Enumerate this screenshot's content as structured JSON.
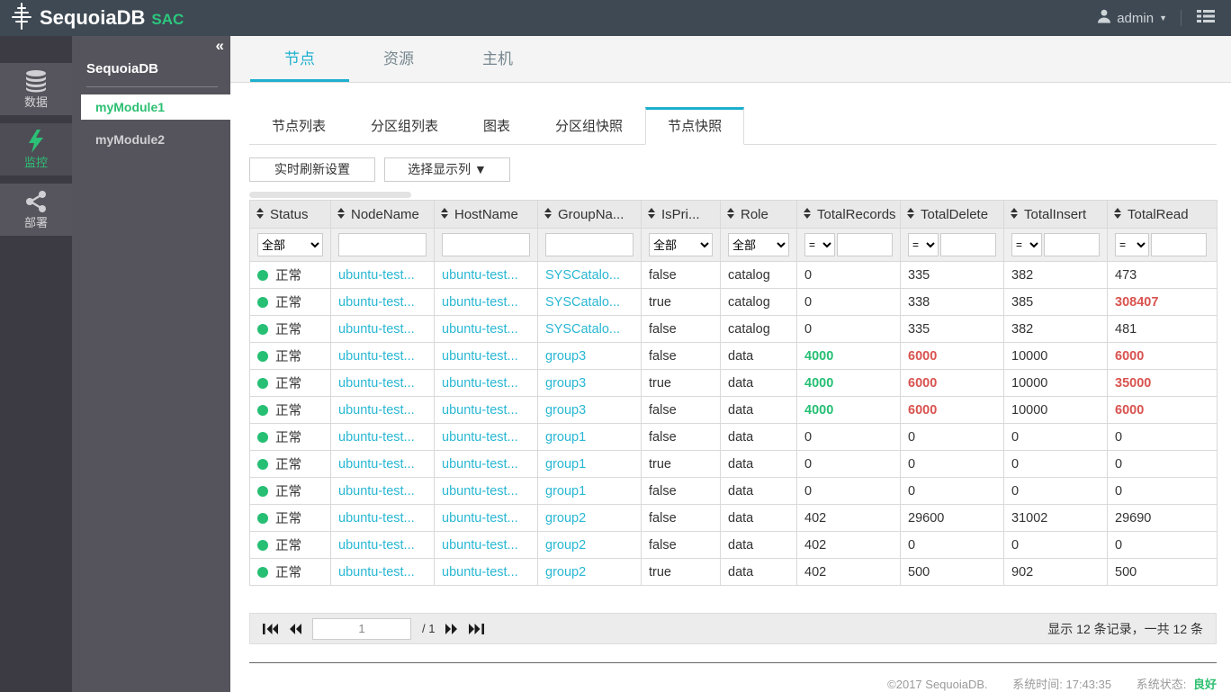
{
  "colors": {
    "accent": "#1db0cf",
    "green": "#26bf74",
    "red": "#d9534f",
    "link": "#29b7d3",
    "brand_green": "#2cc77d",
    "header_bg": "#3e4953"
  },
  "topbar": {
    "brand": "SequoiaDB",
    "brand_suffix": "SAC",
    "user": "admin"
  },
  "rail": {
    "items": [
      {
        "label": "数据",
        "icon": "database-icon",
        "active": false
      },
      {
        "label": "监控",
        "icon": "lightning-icon",
        "active": true
      },
      {
        "label": "部署",
        "icon": "share-icon",
        "active": false
      }
    ]
  },
  "modules": {
    "title": "SequoiaDB",
    "collapse_icon": "«",
    "items": [
      {
        "label": "myModule1",
        "active": true
      },
      {
        "label": "myModule2",
        "active": false
      }
    ]
  },
  "tabs": [
    {
      "label": "节点",
      "active": true
    },
    {
      "label": "资源",
      "active": false
    },
    {
      "label": "主机",
      "active": false
    }
  ],
  "subtabs": [
    {
      "label": "节点列表",
      "active": false
    },
    {
      "label": "分区组列表",
      "active": false
    },
    {
      "label": "图表",
      "active": false
    },
    {
      "label": "分区组快照",
      "active": false
    },
    {
      "label": "节点快照",
      "active": true
    }
  ],
  "toolbar": {
    "refresh_button": "实时刷新设置",
    "columns_button": "选择显示列 ▼"
  },
  "table": {
    "columns": [
      {
        "label": "Status",
        "filter": "select"
      },
      {
        "label": "NodeName",
        "filter": "text"
      },
      {
        "label": "HostName",
        "filter": "text"
      },
      {
        "label": "GroupNa...",
        "filter": "text"
      },
      {
        "label": "IsPri...",
        "filter": "select"
      },
      {
        "label": "Role",
        "filter": "select"
      },
      {
        "label": "TotalRecords",
        "filter": "numeric"
      },
      {
        "label": "TotalDelete",
        "filter": "numeric"
      },
      {
        "label": "TotalInsert",
        "filter": "numeric"
      },
      {
        "label": "TotalRead",
        "filter": "numeric"
      }
    ],
    "filters": {
      "all_label": "全部",
      "eq_label": "="
    },
    "rows": [
      {
        "status": "正常",
        "node": "ubuntu-test...",
        "host": "ubuntu-test...",
        "group": "SYSCatalo...",
        "is_primary": "false",
        "role": "catalog",
        "total_records": {
          "v": "0"
        },
        "total_delete": {
          "v": "335"
        },
        "total_insert": {
          "v": "382"
        },
        "total_read": {
          "v": "473"
        }
      },
      {
        "status": "正常",
        "node": "ubuntu-test...",
        "host": "ubuntu-test...",
        "group": "SYSCatalo...",
        "is_primary": "true",
        "role": "catalog",
        "total_records": {
          "v": "0"
        },
        "total_delete": {
          "v": "338"
        },
        "total_insert": {
          "v": "385"
        },
        "total_read": {
          "v": "308407",
          "c": "red"
        }
      },
      {
        "status": "正常",
        "node": "ubuntu-test...",
        "host": "ubuntu-test...",
        "group": "SYSCatalo...",
        "is_primary": "false",
        "role": "catalog",
        "total_records": {
          "v": "0"
        },
        "total_delete": {
          "v": "335"
        },
        "total_insert": {
          "v": "382"
        },
        "total_read": {
          "v": "481"
        }
      },
      {
        "status": "正常",
        "node": "ubuntu-test...",
        "host": "ubuntu-test...",
        "group": "group3",
        "is_primary": "false",
        "role": "data",
        "total_records": {
          "v": "4000",
          "c": "green"
        },
        "total_delete": {
          "v": "6000",
          "c": "red"
        },
        "total_insert": {
          "v": "10000"
        },
        "total_read": {
          "v": "6000",
          "c": "red"
        }
      },
      {
        "status": "正常",
        "node": "ubuntu-test...",
        "host": "ubuntu-test...",
        "group": "group3",
        "is_primary": "true",
        "role": "data",
        "total_records": {
          "v": "4000",
          "c": "green"
        },
        "total_delete": {
          "v": "6000",
          "c": "red"
        },
        "total_insert": {
          "v": "10000"
        },
        "total_read": {
          "v": "35000",
          "c": "red"
        }
      },
      {
        "status": "正常",
        "node": "ubuntu-test...",
        "host": "ubuntu-test...",
        "group": "group3",
        "is_primary": "false",
        "role": "data",
        "total_records": {
          "v": "4000",
          "c": "green"
        },
        "total_delete": {
          "v": "6000",
          "c": "red"
        },
        "total_insert": {
          "v": "10000"
        },
        "total_read": {
          "v": "6000",
          "c": "red"
        }
      },
      {
        "status": "正常",
        "node": "ubuntu-test...",
        "host": "ubuntu-test...",
        "group": "group1",
        "is_primary": "false",
        "role": "data",
        "total_records": {
          "v": "0"
        },
        "total_delete": {
          "v": "0"
        },
        "total_insert": {
          "v": "0"
        },
        "total_read": {
          "v": "0"
        }
      },
      {
        "status": "正常",
        "node": "ubuntu-test...",
        "host": "ubuntu-test...",
        "group": "group1",
        "is_primary": "true",
        "role": "data",
        "total_records": {
          "v": "0"
        },
        "total_delete": {
          "v": "0"
        },
        "total_insert": {
          "v": "0"
        },
        "total_read": {
          "v": "0"
        }
      },
      {
        "status": "正常",
        "node": "ubuntu-test...",
        "host": "ubuntu-test...",
        "group": "group1",
        "is_primary": "false",
        "role": "data",
        "total_records": {
          "v": "0"
        },
        "total_delete": {
          "v": "0"
        },
        "total_insert": {
          "v": "0"
        },
        "total_read": {
          "v": "0"
        }
      },
      {
        "status": "正常",
        "node": "ubuntu-test...",
        "host": "ubuntu-test...",
        "group": "group2",
        "is_primary": "false",
        "role": "data",
        "total_records": {
          "v": "402"
        },
        "total_delete": {
          "v": "29600"
        },
        "total_insert": {
          "v": "31002"
        },
        "total_read": {
          "v": "29690"
        }
      },
      {
        "status": "正常",
        "node": "ubuntu-test...",
        "host": "ubuntu-test...",
        "group": "group2",
        "is_primary": "false",
        "role": "data",
        "total_records": {
          "v": "402"
        },
        "total_delete": {
          "v": "0"
        },
        "total_insert": {
          "v": "0"
        },
        "total_read": {
          "v": "0"
        }
      },
      {
        "status": "正常",
        "node": "ubuntu-test...",
        "host": "ubuntu-test...",
        "group": "group2",
        "is_primary": "true",
        "role": "data",
        "total_records": {
          "v": "402"
        },
        "total_delete": {
          "v": "500"
        },
        "total_insert": {
          "v": "902"
        },
        "total_read": {
          "v": "500"
        }
      }
    ]
  },
  "pagination": {
    "page": "1",
    "page_count": "/ 1",
    "summary": "显示 12 条记录，一共 12 条"
  },
  "footer": {
    "copyright": "©2017 SequoiaDB.",
    "system_time": "系统时间: 17:43:35",
    "status_label": "系统状态:",
    "status_value": "良好"
  }
}
